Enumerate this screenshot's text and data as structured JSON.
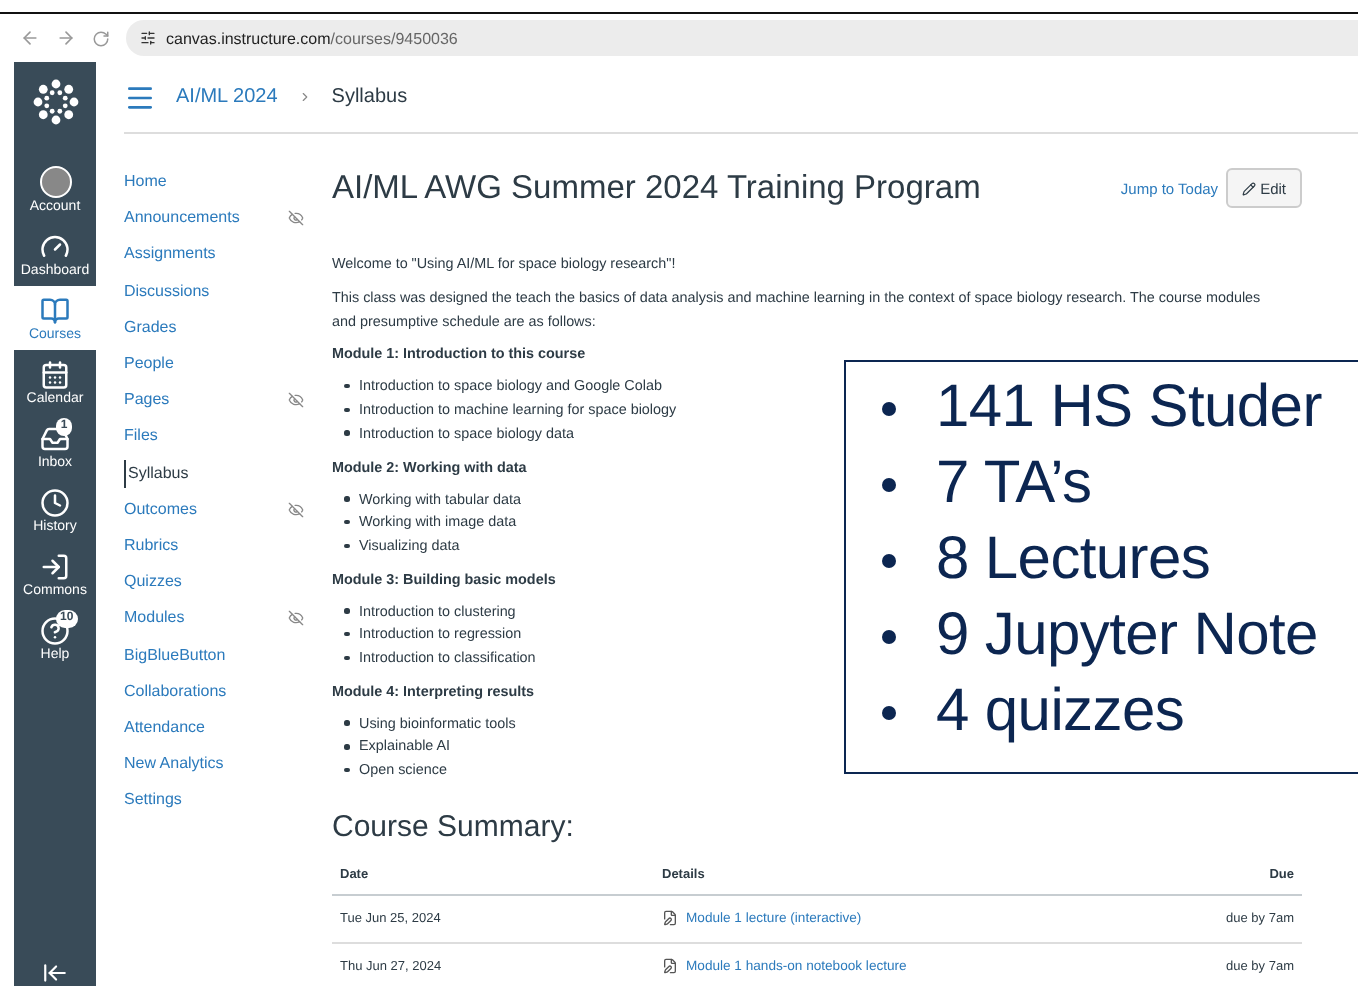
{
  "browser": {
    "host": "canvas.instructure.com",
    "path": "/courses/9450036"
  },
  "global_nav": [
    {
      "label": "Account",
      "selected": false
    },
    {
      "label": "Dashboard",
      "selected": false
    },
    {
      "label": "Courses",
      "selected": true
    },
    {
      "label": "Calendar",
      "selected": false
    },
    {
      "label": "Inbox",
      "selected": false,
      "badge": "1"
    },
    {
      "label": "History",
      "selected": false
    },
    {
      "label": "Commons",
      "selected": false
    },
    {
      "label": "Help",
      "selected": false,
      "badge": "10"
    }
  ],
  "breadcrumb": [
    "AI/ML 2024",
    "Syllabus"
  ],
  "course_nav": [
    {
      "label": "Home",
      "selected": false,
      "hidden": false
    },
    {
      "label": "Announcements",
      "selected": false,
      "hidden": true
    },
    {
      "label": "Assignments",
      "selected": false,
      "hidden": false
    },
    {
      "label": "Discussions",
      "selected": false,
      "hidden": false
    },
    {
      "label": "Grades",
      "selected": false,
      "hidden": false
    },
    {
      "label": "People",
      "selected": false,
      "hidden": false
    },
    {
      "label": "Pages",
      "selected": false,
      "hidden": true
    },
    {
      "label": "Files",
      "selected": false,
      "hidden": false
    },
    {
      "label": "Syllabus",
      "selected": true,
      "hidden": false
    },
    {
      "label": "Outcomes",
      "selected": false,
      "hidden": true
    },
    {
      "label": "Rubrics",
      "selected": false,
      "hidden": false
    },
    {
      "label": "Quizzes",
      "selected": false,
      "hidden": false
    },
    {
      "label": "Modules",
      "selected": false,
      "hidden": true
    },
    {
      "label": "BigBlueButton",
      "selected": false,
      "hidden": false
    },
    {
      "label": "Collaborations",
      "selected": false,
      "hidden": false
    },
    {
      "label": "Attendance",
      "selected": false,
      "hidden": false
    },
    {
      "label": "New Analytics",
      "selected": false,
      "hidden": false
    },
    {
      "label": "Settings",
      "selected": false,
      "hidden": false
    }
  ],
  "page": {
    "title": "AI/ML AWG Summer 2024 Training Program",
    "jump_link": "Jump to Today",
    "edit_button": "Edit",
    "intro": "Welcome to \"Using AI/ML for space biology research\"!",
    "description": "This class was designed the teach the basics of data analysis and machine learning in the context of space biology research.  The course modules and presumptive schedule are as follows:",
    "modules": [
      {
        "heading": "Module 1: Introduction to this course",
        "items": [
          "Introduction to space biology and Google Colab",
          "Introduction to machine learning for space biology",
          "Introduction to space biology data"
        ]
      },
      {
        "heading": "Module 2: Working with data",
        "items": [
          "Working with tabular data",
          "Working with image data",
          "Visualizing data"
        ]
      },
      {
        "heading": "Module 3: Building basic models",
        "items": [
          "Introduction to clustering",
          "Introduction to regression",
          "Introduction to classification"
        ]
      },
      {
        "heading": "Module 4: Interpreting results",
        "items": [
          "Using bioinformatic tools",
          "Explainable AI",
          "Open science"
        ]
      }
    ]
  },
  "summary": {
    "title": "Course Summary:",
    "columns": [
      "Date",
      "Details",
      "Due"
    ],
    "rows": [
      {
        "date": "Tue Jun 25, 2024",
        "details": "Module 1 lecture (interactive)",
        "due": "due by 7am"
      },
      {
        "date": "Thu Jun 27, 2024",
        "details": "Module 1 hands-on notebook lecture",
        "due": "due by 7am"
      }
    ]
  },
  "overlay": {
    "items": [
      "141 HS Studer",
      "7 TA’s",
      "8 Lectures",
      "9 Jupyter Note",
      "4 quizzes"
    ]
  }
}
